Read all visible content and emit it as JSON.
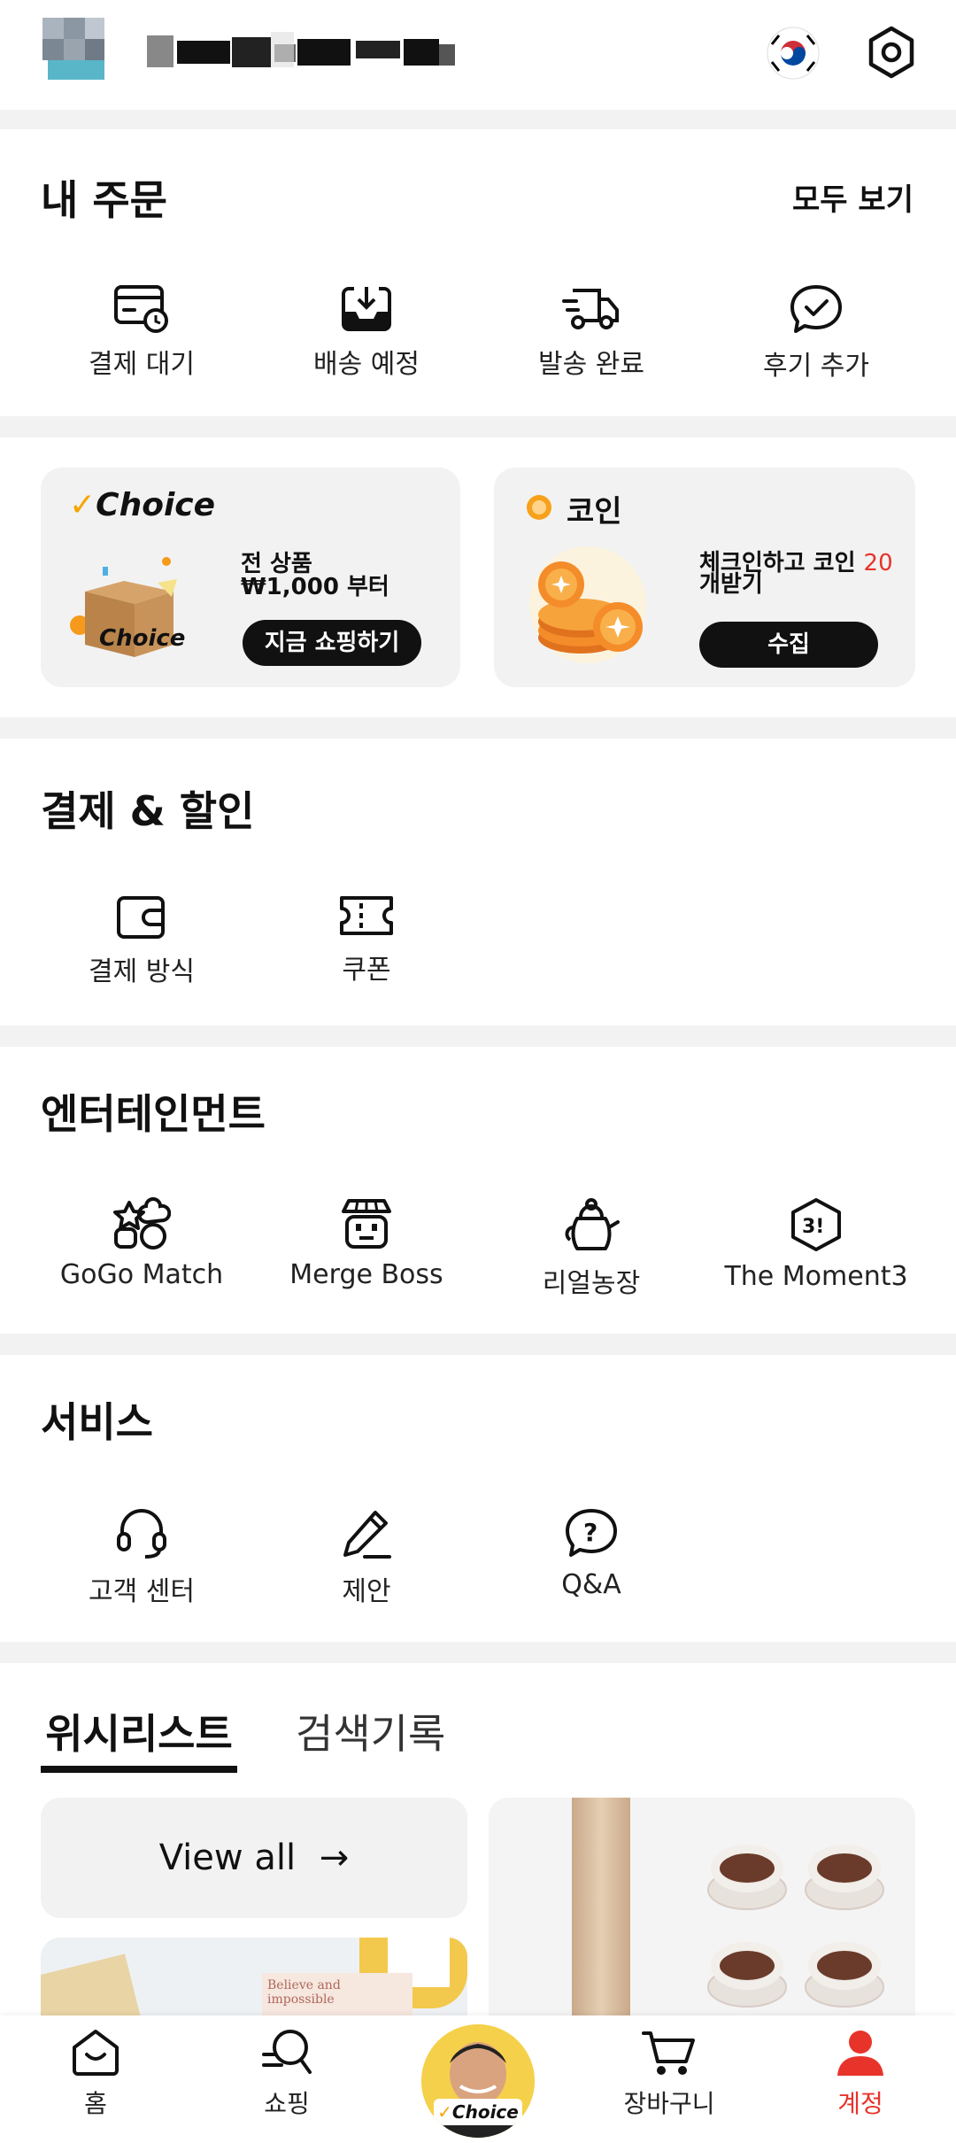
{
  "colors": {
    "accent": "#e8332a",
    "choice": "#f7a400",
    "dark": "#111111",
    "bg": "#f2f2f2"
  },
  "header": {
    "flag_icon": "korea-flag-icon",
    "settings_icon": "gear-icon"
  },
  "orders": {
    "title": "내 주문",
    "view_all": "모두 보기",
    "items": [
      {
        "label": "결제 대기",
        "icon": "payment-pending-icon"
      },
      {
        "label": "배송 예정",
        "icon": "to-ship-icon"
      },
      {
        "label": "발송 완료",
        "icon": "shipped-truck-icon"
      },
      {
        "label": "후기 추가",
        "icon": "review-bubble-icon"
      }
    ]
  },
  "promo": {
    "choice": {
      "brand": "Choice",
      "text": "전 상품 ₩1,000 부터",
      "button": "지금 쇼핑하기",
      "box_text": "Choice"
    },
    "coin": {
      "title": "코인",
      "text_main": "체크인하고 코인 ",
      "text_amount": "20",
      "text_tail": "개받기",
      "button": "수집"
    }
  },
  "payment": {
    "title": "결제 & 할인",
    "items": [
      {
        "label": "결제 방식",
        "icon": "wallet-icon"
      },
      {
        "label": "쿠폰",
        "icon": "coupon-icon"
      }
    ]
  },
  "entertainment": {
    "title": "엔터테인먼트",
    "items": [
      {
        "label": "GoGo Match",
        "icon": "gogo-match-icon"
      },
      {
        "label": "Merge Boss",
        "icon": "merge-boss-icon"
      },
      {
        "label": "리얼농장",
        "icon": "watering-can-icon"
      },
      {
        "label": "The Moment3",
        "icon": "moment3-icon"
      }
    ]
  },
  "services": {
    "title": "서비스",
    "items": [
      {
        "label": "고객 센터",
        "icon": "headset-icon"
      },
      {
        "label": "제안",
        "icon": "pencil-icon"
      },
      {
        "label": "Q&A",
        "icon": "question-bubble-icon"
      }
    ]
  },
  "tabs": {
    "wishlist": "위시리스트",
    "history": "검색기록",
    "view_all": "View all"
  },
  "product_card_text": "Believe and impossible",
  "nav": {
    "home": "홈",
    "shopping": "쇼핑",
    "choice": "Choice",
    "cart": "장바구니",
    "account": "계정"
  }
}
